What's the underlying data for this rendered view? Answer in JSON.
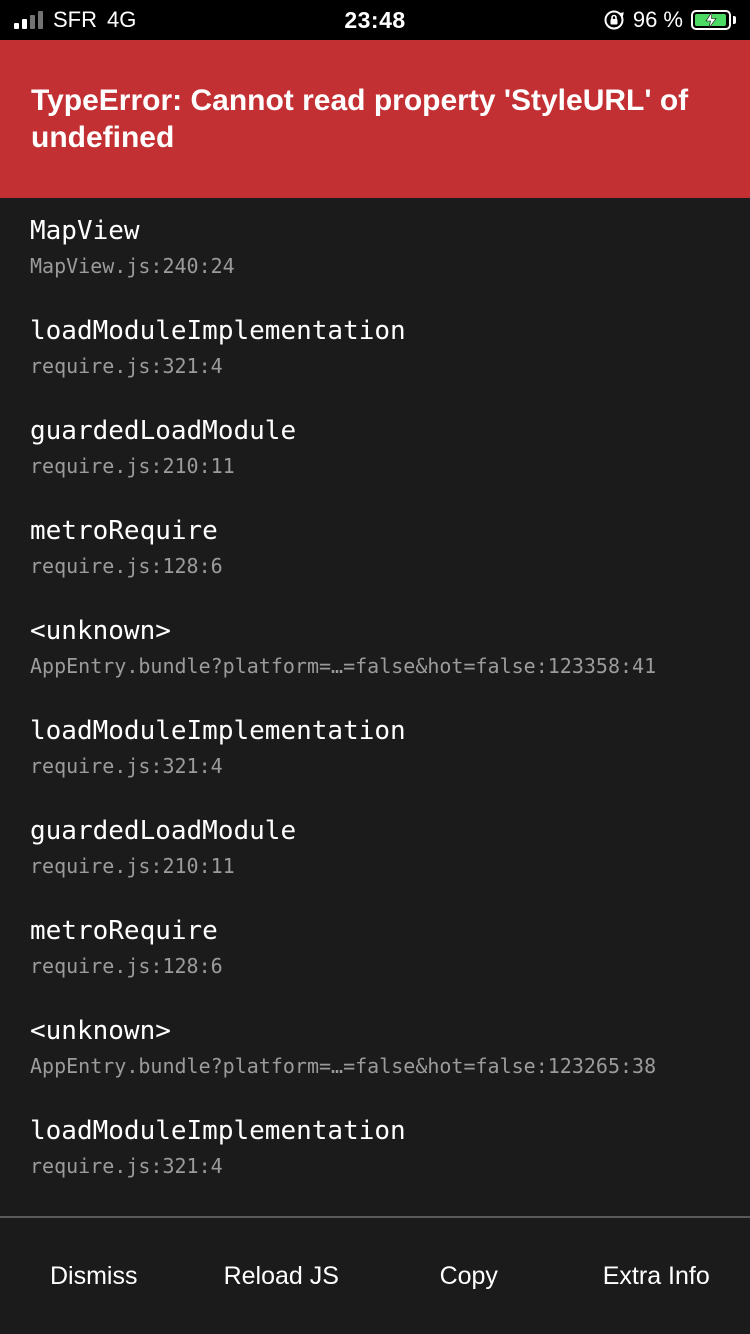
{
  "status_bar": {
    "carrier": "SFR",
    "network": "4G",
    "time": "23:48",
    "battery_percent": "96 %",
    "battery_level": 0.96,
    "battery_color": "#4cd964"
  },
  "error": {
    "title": "TypeError: Cannot read property 'StyleURL' of undefined",
    "color": "#c33034"
  },
  "stack": [
    {
      "name": "MapView",
      "location": "MapView.js:240:24"
    },
    {
      "name": "loadModuleImplementation",
      "location": "require.js:321:4"
    },
    {
      "name": "guardedLoadModule",
      "location": "require.js:210:11"
    },
    {
      "name": "metroRequire",
      "location": "require.js:128:6"
    },
    {
      "name": "<unknown>",
      "location": "AppEntry.bundle?platform=…=false&hot=false:123358:41"
    },
    {
      "name": "loadModuleImplementation",
      "location": "require.js:321:4"
    },
    {
      "name": "guardedLoadModule",
      "location": "require.js:210:11"
    },
    {
      "name": "metroRequire",
      "location": "require.js:128:6"
    },
    {
      "name": "<unknown>",
      "location": "AppEntry.bundle?platform=…=false&hot=false:123265:38"
    },
    {
      "name": "loadModuleImplementation",
      "location": "require.js:321:4"
    }
  ],
  "toolbar": {
    "dismiss": "Dismiss",
    "reload": "Reload JS",
    "copy": "Copy",
    "extra": "Extra Info"
  }
}
